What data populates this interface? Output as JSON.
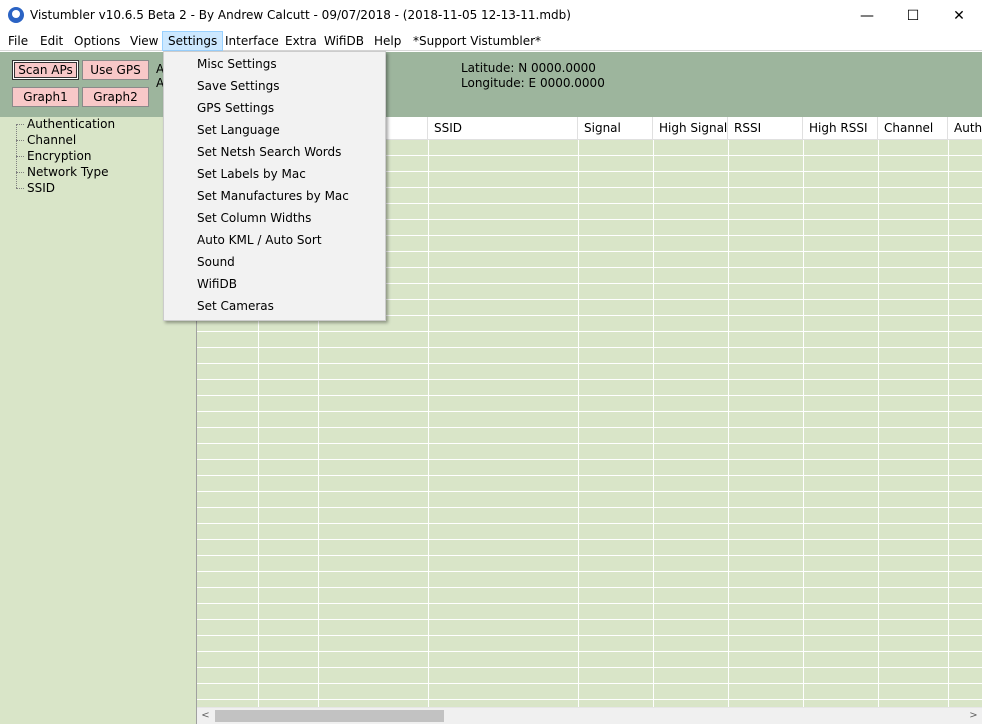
{
  "window": {
    "title": "Vistumbler v10.6.5 Beta 2 - By Andrew Calcutt - 09/07/2018 - (2018-11-05 12-13-11.mdb)",
    "minimize": "—",
    "maximize": "☐",
    "close": "✕"
  },
  "menu": {
    "items": [
      "File",
      "Edit",
      "Options",
      "View",
      "Settings",
      "Interface",
      "Extra",
      "WifiDB",
      "Help",
      "*Support Vistumbler*"
    ]
  },
  "toolbar": {
    "scan_aps": "Scan APs",
    "use_gps": "Use GPS",
    "graph1": "Graph1",
    "graph2": "Graph2",
    "partial_label_1": "A",
    "partial_label_2": "A",
    "latitude": "Latitude: N 0000.0000",
    "longitude": "Longitude: E 0000.0000"
  },
  "tree": {
    "items": [
      "Authentication",
      "Channel",
      "Encryption",
      "Network Type",
      "SSID"
    ]
  },
  "grid": {
    "columns": [
      "SSID",
      "Signal",
      "High Signal",
      "RSSI",
      "High RSSI",
      "Channel",
      "Authe"
    ]
  },
  "settings_menu": {
    "items": [
      "Misc Settings",
      "Save Settings",
      "GPS Settings",
      "Set Language",
      "Set Netsh Search Words",
      "Set Labels by Mac",
      "Set Manufactures by Mac",
      "Set Column Widths",
      "Auto KML / Auto Sort",
      "Sound",
      "WifiDB",
      "Set Cameras"
    ]
  },
  "scrollbar": {
    "left_arrow": "<",
    "right_arrow": ">"
  },
  "colors": {
    "toolbar_bg": "#9db59d",
    "panel_bg": "#d9e5c8",
    "button_bg": "#f8c8c8",
    "menu_highlight": "#cce8ff"
  }
}
